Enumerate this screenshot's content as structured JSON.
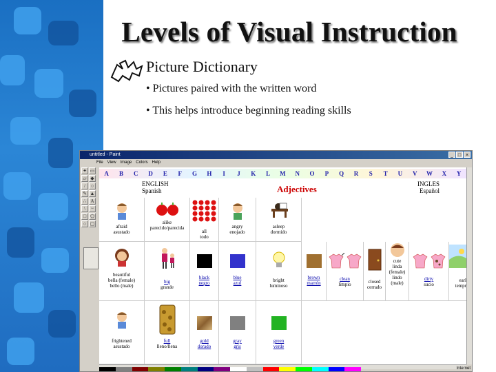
{
  "slide": {
    "title": "Levels of Visual Instruction",
    "heading": "Picture Dictionary",
    "bullets": [
      "• Pictures paired with the written word",
      "• This helps introduce beginning reading skills"
    ]
  },
  "paint": {
    "window_title": "untitled - Paint",
    "menus": [
      "File",
      "View",
      "Image",
      "Colors",
      "Help"
    ],
    "alphabet": [
      "A",
      "B",
      "C",
      "D",
      "E",
      "F",
      "G",
      "H",
      "I",
      "J",
      "K",
      "L",
      "M",
      "N",
      "O",
      "P",
      "Q",
      "R",
      "S",
      "T",
      "U",
      "V",
      "W",
      "X",
      "Y"
    ],
    "label_english": "ENGLISH",
    "label_spanish": "Spanish",
    "heading": "Adjectives",
    "label_ingles": "INGLES",
    "label_espanol": "Español",
    "taskbar_text": "Internet",
    "row1": [
      {
        "lines": [
          "afraid",
          "asustado"
        ]
      },
      {
        "lines": [
          "alike",
          "parecido/parecida"
        ]
      },
      {
        "lines": [
          "all",
          "todo"
        ]
      },
      {
        "lines": [
          "angry",
          "enojado"
        ]
      },
      {
        "lines": [
          "asleep",
          "dormido"
        ]
      }
    ],
    "row2": [
      {
        "lines": [
          "beautiful",
          "bella (female)",
          "bello (male)"
        ]
      },
      {
        "lines": [
          "big",
          "grande"
        ]
      },
      {
        "lines": [
          "black",
          "negro"
        ]
      },
      {
        "lines": [
          "blue",
          "azul"
        ]
      },
      {
        "lines": [
          "bright",
          "luminoso"
        ]
      },
      {
        "lines": [
          "brown",
          "marrón"
        ]
      },
      {
        "lines": [
          "clean",
          "limpio"
        ]
      },
      {
        "lines": [
          "closed",
          "cerrado"
        ]
      },
      {
        "lines": [
          "cute",
          "linda",
          "(female)",
          "lindo",
          "(male)"
        ]
      },
      {
        "lines": [
          "dirty",
          "sucio"
        ]
      },
      {
        "lines": [
          "earl",
          "tempr"
        ]
      }
    ],
    "row3": [
      {
        "lines": [
          "frightened",
          "asustado"
        ]
      },
      {
        "lines": [
          "full",
          "lleno/llena"
        ]
      },
      {
        "lines": [
          "gold",
          "dorado"
        ]
      },
      {
        "lines": [
          "gray",
          "gris"
        ]
      },
      {
        "lines": [
          "green",
          "verde"
        ]
      }
    ]
  },
  "colors": {
    "black": "#000000",
    "blue": "#3232cc",
    "brown": "#a07030",
    "gray": "#808080",
    "green": "#22b322",
    "title_bar": "#0a246a"
  }
}
